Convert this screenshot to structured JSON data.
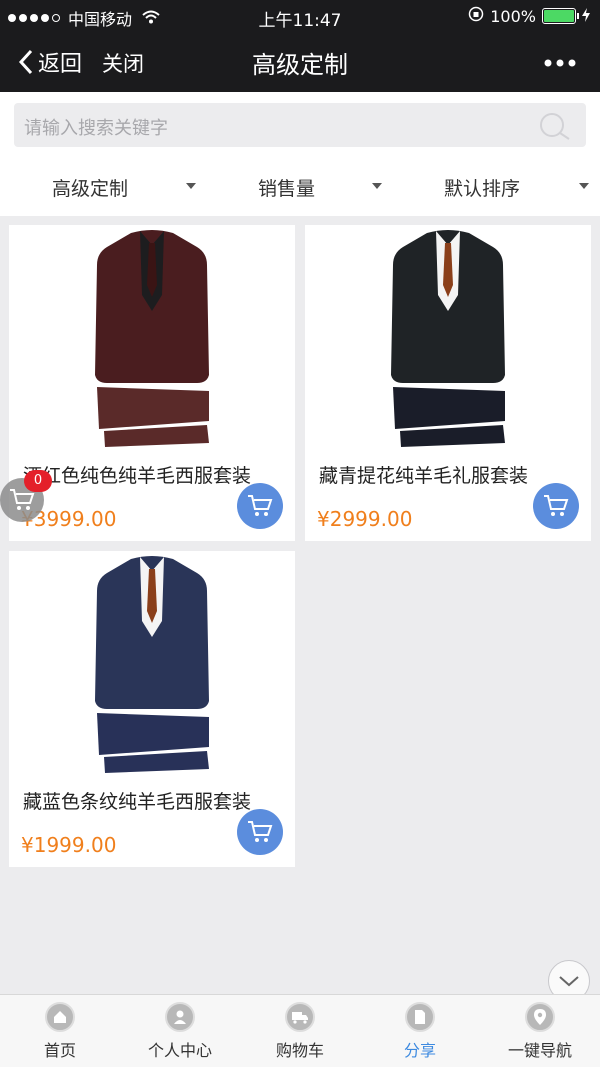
{
  "status_bar": {
    "carrier": "中国移动",
    "time": "上午11:47",
    "battery": "100%"
  },
  "navbar": {
    "back_label": "返回",
    "close_label": "关闭",
    "title": "高级定制",
    "more_icon": "more-dots-icon"
  },
  "search": {
    "placeholder": "请输入搜索关键字"
  },
  "filters": [
    {
      "label": "高级定制"
    },
    {
      "label": "销售量"
    },
    {
      "label": "默认排序"
    }
  ],
  "products": [
    {
      "name": "酒红色纯色纯羊毛西服套装",
      "price": "¥3999.00",
      "jacket_color": "#4a1d1f",
      "pants_color": "#5a2a29",
      "shirt_color": "#1d1d1f",
      "tie_color": "#3a1414"
    },
    {
      "name": "藏青提花纯羊毛礼服套装",
      "price": "¥2999.00",
      "jacket_color": "#1f2326",
      "pants_color": "#1a1d29",
      "shirt_color": "#f4f4f4",
      "tie_color": "#8a3f1a"
    },
    {
      "name": "藏蓝色条纹纯羊毛西服套装",
      "price": "¥1999.00",
      "jacket_color": "#2a3558",
      "pants_color": "#283158",
      "shirt_color": "#f4f4f4",
      "tie_color": "#8a3f1a"
    }
  ],
  "floating_cart": {
    "count": "0"
  },
  "tabbar": [
    {
      "label": "首页",
      "active": false
    },
    {
      "label": "个人中心",
      "active": false
    },
    {
      "label": "购物车",
      "active": false
    },
    {
      "label": "分享",
      "active": true
    },
    {
      "label": "一键导航",
      "active": false
    }
  ],
  "colors": {
    "accent": "#5b8ddd",
    "price": "#f07f1c",
    "badge": "#e4202a",
    "active_tab": "#3d8ae0"
  }
}
